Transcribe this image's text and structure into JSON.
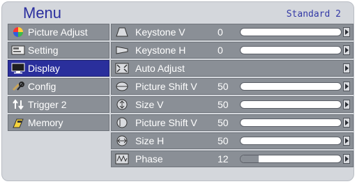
{
  "menu": {
    "title": "Menu",
    "preset": "Standard 2",
    "items": [
      {
        "label": "Picture Adjust",
        "icon": "color-ball-icon"
      },
      {
        "label": "Setting",
        "icon": "settings-panel-icon"
      },
      {
        "label": "Display",
        "icon": "display-monitor-icon",
        "selected": true
      },
      {
        "label": "Config",
        "icon": "tools-icon"
      },
      {
        "label": "Trigger 2",
        "icon": "trigger-icon"
      },
      {
        "label": "Memory",
        "icon": "memory-card-icon"
      }
    ]
  },
  "settings": {
    "rows": [
      {
        "label": "Keystone V",
        "value": "0",
        "level": 0.0,
        "icon": "keystone-v-icon"
      },
      {
        "label": "Keystone H",
        "value": "0",
        "level": 0.0,
        "icon": "keystone-h-icon"
      },
      {
        "label": "Auto Adjust",
        "value": "",
        "level": null,
        "icon": "auto-adjust-icon"
      },
      {
        "label": "Picture Shift V",
        "value": "50",
        "level": 0.0,
        "icon": "picture-shift-v-icon"
      },
      {
        "label": "Size V",
        "value": "50",
        "level": 0.0,
        "icon": "size-v-icon"
      },
      {
        "label": "Picture Shift V",
        "value": "50",
        "level": 0.0,
        "icon": "picture-shift-v2-icon"
      },
      {
        "label": "Size H",
        "value": "50",
        "level": 0.0,
        "icon": "size-h-icon"
      },
      {
        "label": "Phase",
        "value": "12",
        "level": 0.18,
        "icon": "phase-icon"
      }
    ]
  },
  "colors": {
    "accent": "#2a2f9c",
    "panel_background": "#d4d7dc",
    "row_background": "#8a8f96"
  }
}
